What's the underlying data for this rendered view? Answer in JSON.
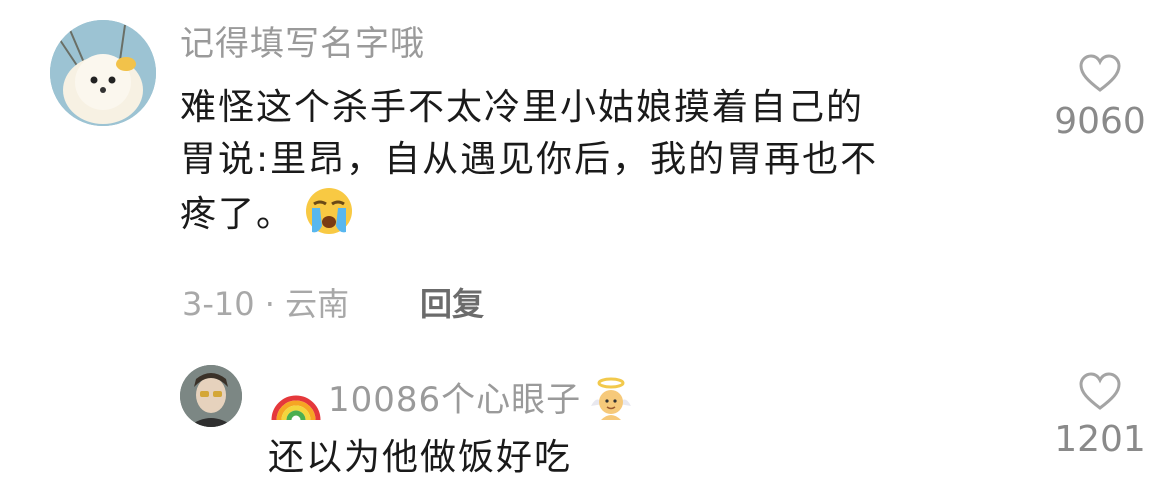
{
  "comments": [
    {
      "username": "记得填写名字哦",
      "text_lines": [
        "难怪这个杀手不太冷里小姑娘摸着自己的",
        "胃说:里昂，自从遇见你后，我的胃再也不",
        "疼了。"
      ],
      "emoji": "crying-face-icon",
      "date_location": "3-10 · 云南",
      "reply_label": "回复",
      "likes": "9060"
    },
    {
      "username": "10086个心眼子",
      "text": "还以为他做饭好吃",
      "likes": "1201"
    }
  ],
  "colors": {
    "username": "#9a9a9a",
    "text": "#1a1a1a",
    "meta": "#a8a8a8",
    "reply": "#6b6b6b",
    "like": "#8a8a8a"
  }
}
